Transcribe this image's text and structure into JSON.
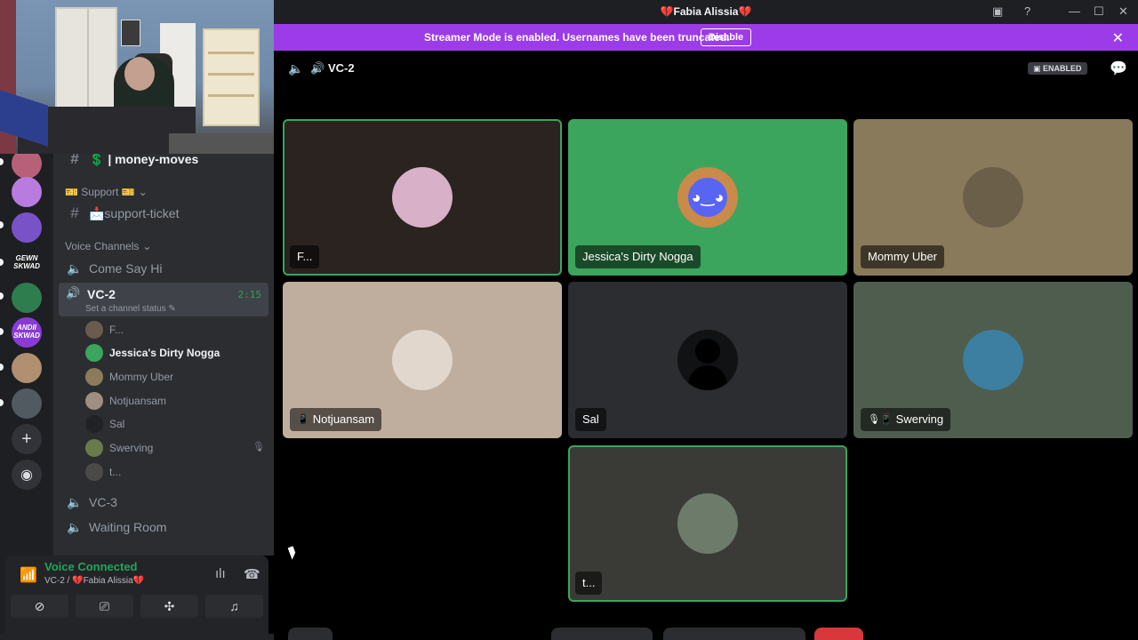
{
  "window": {
    "title": "💔Fabia Alissia💔",
    "controls": [
      "inbox-icon",
      "help-icon",
      "minimize-icon",
      "maximize-icon",
      "close-icon"
    ]
  },
  "banner": {
    "text": "Streamer Mode is enabled. Usernames have been truncated.",
    "button": "Disable",
    "bg": "#9b3ce8"
  },
  "sidebar": {
    "text_channels": [
      {
        "name": "💲 | money-moves"
      },
      {
        "name": "📩support-ticket"
      }
    ],
    "support_category": "🎫 Support 🎫",
    "voice_category": "Voice Channels",
    "voice_channels_top": [
      {
        "name": "Come Say Hi"
      }
    ],
    "active_channel": {
      "name": "VC-2",
      "timer": "2:15",
      "status_placeholder": "Set a channel status"
    },
    "members": [
      {
        "name": "F...",
        "color": "#6b5a4e"
      },
      {
        "name": "Jessica's Dirty Nogga",
        "color": "#3ba55d"
      },
      {
        "name": "Mommy Uber",
        "color": "#8b7b5a"
      },
      {
        "name": "Notjuansam",
        "color": "#a08e80"
      },
      {
        "name": "Sal",
        "color": "#202225"
      },
      {
        "name": "Swerving",
        "color": "#6a7a4a"
      },
      {
        "name": "t...",
        "color": "#4a4a4a"
      }
    ],
    "voice_channels_bottom": [
      {
        "name": "VC-3"
      },
      {
        "name": "Waiting Room"
      }
    ]
  },
  "servers": [
    {
      "label": "",
      "color": "#b8607a"
    },
    {
      "label": "",
      "color": "#b87ce0"
    },
    {
      "label": "",
      "color": "#7a52c7"
    },
    {
      "label": "GEWN SKWAD",
      "color": "#1e1f22"
    },
    {
      "label": "",
      "color": "#2e7d4f"
    },
    {
      "label": "ANDII SKWAD",
      "color": "#8a3bd6"
    },
    {
      "label": "",
      "color": "#b09070"
    },
    {
      "label": "",
      "color": "#505a60"
    }
  ],
  "voice_panel": {
    "status": "Voice Connected",
    "location": "VC-2 / 💔Fabia Alissia💔",
    "status_color": "#23a55a"
  },
  "stage": {
    "channel": "VC-2",
    "streamer_badge": "ENABLED",
    "tiles": [
      {
        "label": "F...",
        "bg": "#2a2320",
        "avatar": "#d8b0c8",
        "speaking": true,
        "icons": ""
      },
      {
        "label": "Jessica's Dirty Nogga",
        "bg": "#3ba55d",
        "avatar": "#5865f2",
        "speaking": true,
        "icons": ""
      },
      {
        "label": "Mommy Uber",
        "bg": "#8a7a5c",
        "avatar": "#6b5f4a",
        "speaking": false,
        "icons": ""
      },
      {
        "label": "Notjuansam",
        "bg": "#bfae9e",
        "avatar": "#e2d7cc",
        "speaking": false,
        "icons": "📱"
      },
      {
        "label": "Sal",
        "bg": "#2b2d31",
        "avatar": "#111214",
        "speaking": false,
        "icons": ""
      },
      {
        "label": "Swerving",
        "bg": "#4f5d4e",
        "avatar": "#3c7fa0",
        "speaking": false,
        "icons": "🎙📱"
      },
      {
        "label": "t...",
        "bg": "#3a3b36",
        "avatar": "#6c7b6a",
        "speaking": true,
        "icons": ""
      }
    ]
  }
}
